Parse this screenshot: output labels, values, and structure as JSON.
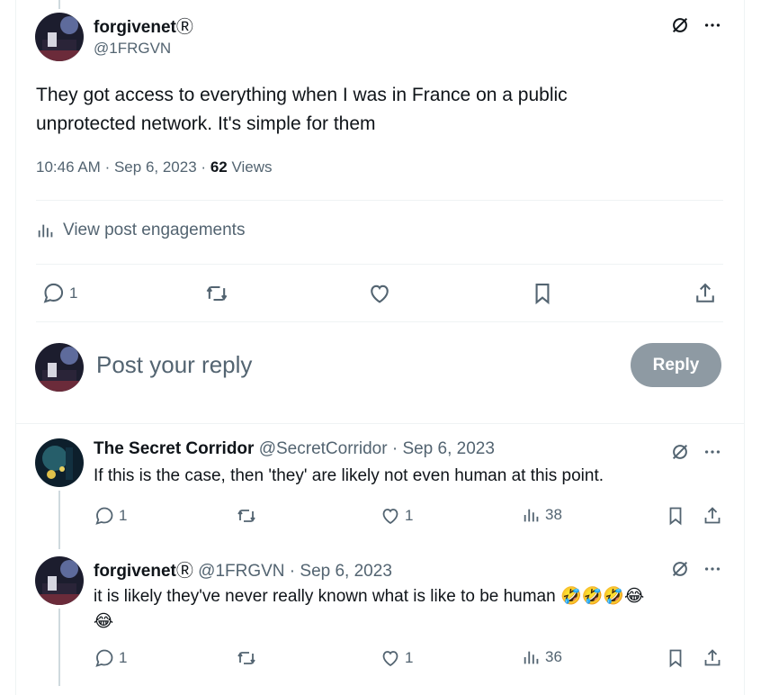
{
  "main_post": {
    "author_name": "forgivenet",
    "author_badge": "Ⓡ",
    "handle": "@1FRGVN",
    "text_line1": "They got access to everything when I was in France on a public",
    "text_line2": "unprotected network. It's simple for them",
    "time": "10:46 AM",
    "date": "Sep 6, 2023",
    "views_count": "62",
    "views_label": "Views",
    "engagements_label": "View post engagements",
    "reply_count": "1"
  },
  "composer": {
    "placeholder": "Post your reply",
    "reply_button": "Reply"
  },
  "replies": [
    {
      "author_name": "The Secret Corridor",
      "handle": "@SecretCorridor",
      "date": "Sep 6, 2023",
      "text": "If this is the case, then 'they' are likely not even human at this point.",
      "reply_count": "1",
      "like_count": "1",
      "views_count": "38"
    },
    {
      "author_name": "forgivenet",
      "author_badge": "Ⓡ",
      "handle": "@1FRGVN",
      "date": "Sep 6, 2023",
      "text": "it is likely they've never really known what is like to be human 🤣🤣🤣😂",
      "text_line2": "😂",
      "reply_count": "1",
      "like_count": "1",
      "views_count": "36"
    }
  ],
  "separator": "·",
  "colors": {
    "text": "#0f1419",
    "muted": "#536471",
    "divider": "#eff3f4",
    "reply_button": "#8e9aa3"
  }
}
